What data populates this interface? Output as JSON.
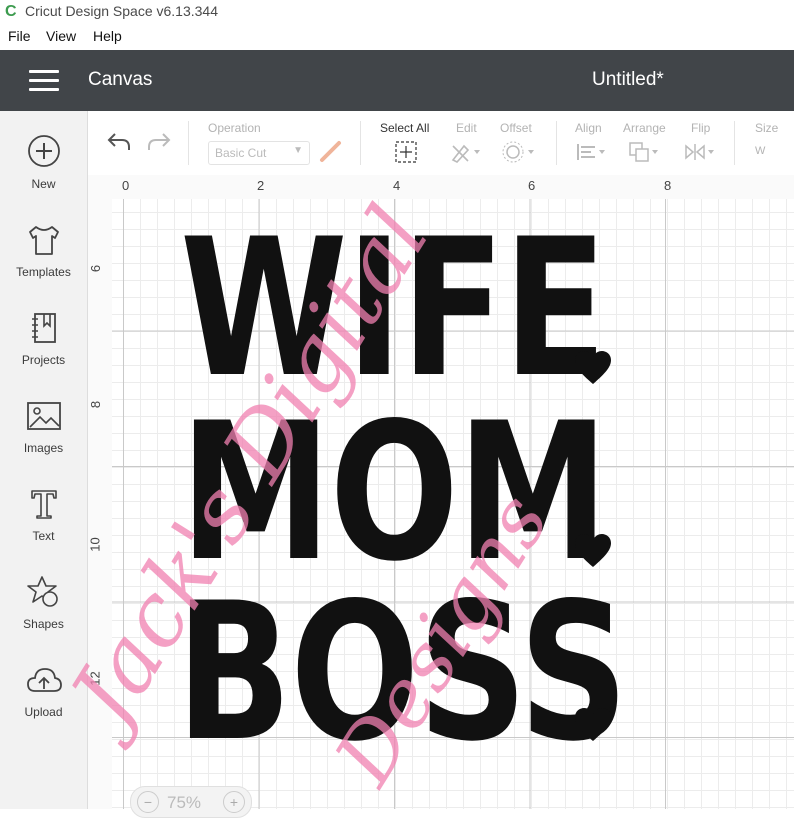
{
  "app": {
    "logo_glyph": "C",
    "title": "Cricut Design Space  v6.13.344"
  },
  "menu": [
    {
      "label": "File"
    },
    {
      "label": "View"
    },
    {
      "label": "Help"
    }
  ],
  "header": {
    "section": "Canvas",
    "document_title": "Untitled*"
  },
  "sidebar": [
    {
      "label": "New",
      "icon": "plus-circle-icon"
    },
    {
      "label": "Templates",
      "icon": "tshirt-icon"
    },
    {
      "label": "Projects",
      "icon": "notebook-icon"
    },
    {
      "label": "Images",
      "icon": "image-icon"
    },
    {
      "label": "Text",
      "icon": "text-icon"
    },
    {
      "label": "Shapes",
      "icon": "shapes-icon"
    },
    {
      "label": "Upload",
      "icon": "cloud-upload-icon"
    }
  ],
  "toolbar": {
    "operation_label": "Operation",
    "operation_value": "Basic Cut",
    "select_all_label": "Select All",
    "edit_label": "Edit",
    "offset_label": "Offset",
    "align_label": "Align",
    "arrange_label": "Arrange",
    "flip_label": "Flip",
    "size_label": "Size",
    "size_w_label": "W"
  },
  "ruler": {
    "top": [
      "0",
      "2",
      "4",
      "6",
      "8"
    ],
    "left": [
      "6",
      "8",
      "10",
      "12"
    ]
  },
  "design": {
    "words": [
      "WIFE",
      "MOM",
      "BOSS"
    ],
    "color": "#111111"
  },
  "watermark": {
    "line1": "Jack's Digital",
    "line2": "Designs",
    "color": "#f080b0"
  },
  "zoom": {
    "value": "75%",
    "minus": "−",
    "plus": "+"
  }
}
